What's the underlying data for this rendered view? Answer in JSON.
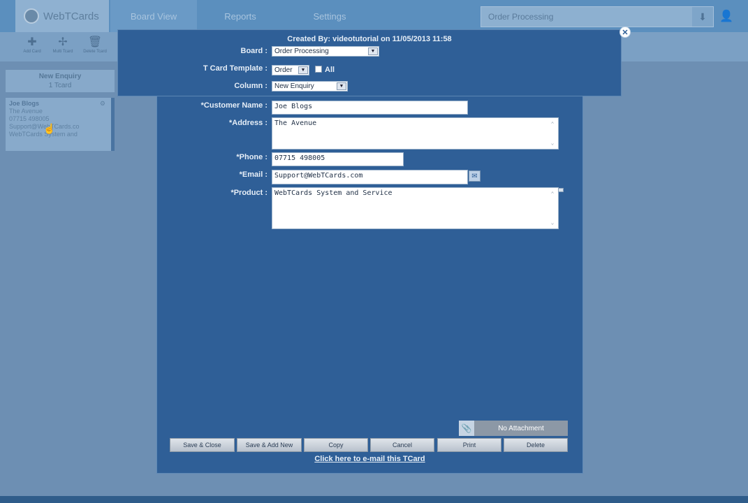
{
  "app": {
    "logo_text": "WebTCards",
    "nav": [
      "Board View",
      "Reports",
      "Settings"
    ],
    "board_search_value": "Order Processing",
    "toolbar": [
      "Add Card",
      "Multi Tcard",
      "Delete Tcard"
    ]
  },
  "board": {
    "column_title": "New Enquiry",
    "column_count": "1 Tcard",
    "card": {
      "name": "Joe Blogs",
      "line1": "The Avenue",
      "line2": "07715 498005",
      "line3": "Support@WebTCards.co",
      "line4": "WebTCards System and"
    }
  },
  "modal": {
    "created_by": "Created By: videotutorial on 11/05/2013 11:58",
    "board_label": "Board :",
    "board_value": "Order Processing",
    "template_label": "T Card Template :",
    "template_value": "Order",
    "all_label": "All",
    "column_label": "Column :",
    "column_value": "New Enquiry",
    "fields": {
      "customer_name_label": "*Customer Name :",
      "customer_name_value": "Joe Blogs",
      "address_label": "*Address :",
      "address_value": "The Avenue",
      "phone_label": "*Phone :",
      "phone_value": "07715 498005",
      "email_label": "*Email :",
      "email_value": "Support@WebTCards.com",
      "product_label": "*Product :",
      "product_value": "WebTCards System and Service"
    },
    "attachment": "No Attachment",
    "buttons": {
      "save_close": "Save & Close",
      "save_add_new": "Save & Add New",
      "copy": "Copy",
      "cancel": "Cancel",
      "print": "Print",
      "delete": "Delete"
    },
    "email_link": "Click here to e-mail this TCard"
  },
  "colors": {
    "modal_bg": "#2f5f97",
    "overlay": "#6d8fb3"
  }
}
